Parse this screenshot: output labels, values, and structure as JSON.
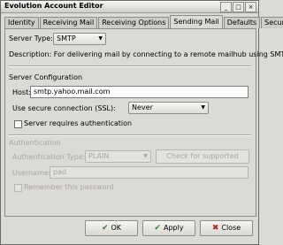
{
  "window": {
    "title": "Evolution Account Editor"
  },
  "tabs": [
    "Identity",
    "Receiving Mail",
    "Receiving Options",
    "Sending Mail",
    "Defaults",
    "Security"
  ],
  "server_type": {
    "label": "Server Type:",
    "value": "SMTP"
  },
  "description": "Description: For delivering mail by connecting to a remote mailhub using SMTP.",
  "server_config": {
    "heading": "Server Configuration",
    "host_label": "Host:",
    "host_value": "smtp.yahoo.mail.com",
    "ssl_label": "Use secure connection (SSL):",
    "ssl_value": "Never",
    "requires_auth": "Server requires authentication"
  },
  "authentication": {
    "heading": "Authentication",
    "type_label": "Authentication Type:",
    "type_value": "PLAIN",
    "check_button": "Check for supported types",
    "username_label": "Username:",
    "username_value": "pad",
    "remember": "Remember this password"
  },
  "buttons": {
    "ok": "OK",
    "apply": "Apply",
    "close": "Close"
  }
}
